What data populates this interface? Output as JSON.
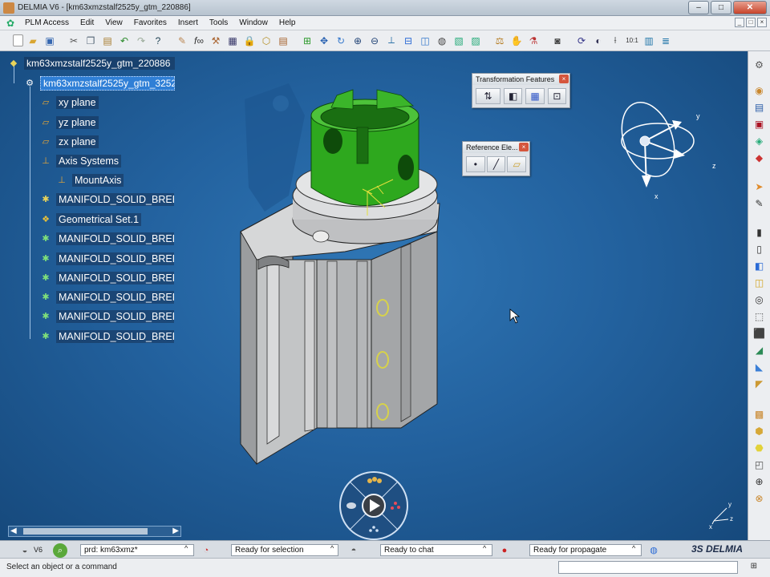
{
  "window": {
    "title": "DELMIA V6 - [km63xmzstalf2525y_gtm_220886]",
    "minimize": "–",
    "maximize": "□",
    "close": "✕"
  },
  "menu": {
    "items": [
      "PLM Access",
      "Edit",
      "View",
      "Favorites",
      "Insert",
      "Tools",
      "Window",
      "Help"
    ]
  },
  "tree": {
    "root": "km63xmzstalf2525y_gtm_220886",
    "selected": "km63xmzstalf2525y_gtm_3252",
    "items": [
      {
        "label": "xy plane",
        "icon": "plane-icon"
      },
      {
        "label": "yz plane",
        "icon": "plane-icon"
      },
      {
        "label": "zx plane",
        "icon": "plane-icon"
      },
      {
        "label": "Axis Systems",
        "icon": "axis-system-icon"
      },
      {
        "label": "MountAxis",
        "icon": "axis-icon"
      },
      {
        "label": "MANIFOLD_SOLID_BREP #",
        "icon": "brep-icon"
      },
      {
        "label": "Geometrical Set.1",
        "icon": "geoset-icon"
      },
      {
        "label": "MANIFOLD_SOLID_BREP #",
        "icon": "brep-icon"
      },
      {
        "label": "MANIFOLD_SOLID_BREP #",
        "icon": "brep-icon"
      },
      {
        "label": "MANIFOLD_SOLID_BREP #",
        "icon": "brep-icon"
      },
      {
        "label": "MANIFOLD_SOLID_BREP #",
        "icon": "brep-icon"
      },
      {
        "label": "MANIFOLD_SOLID_BREP #",
        "icon": "brep-icon"
      },
      {
        "label": "MANIFOLD_SOLID_BREP #",
        "icon": "brep-icon"
      }
    ]
  },
  "floating_toolbars": {
    "transformation": {
      "title": "Transformation Features"
    },
    "reference": {
      "title": "Reference Ele..."
    }
  },
  "compass": {
    "x": "x",
    "y": "y",
    "z": "z"
  },
  "status": {
    "field1": "prd: km63xmz*",
    "field2": "Ready for selection",
    "field3": "Ready to chat",
    "field4": "Ready for propagate",
    "v6": "V6",
    "prompt": "Select an object or a command",
    "brand": "3S DELMIA"
  },
  "colors": {
    "viewport": "#23629f",
    "part_green": "#2ea81e",
    "part_grey": "#bfc1c3",
    "selection": "#2f7fd6"
  }
}
